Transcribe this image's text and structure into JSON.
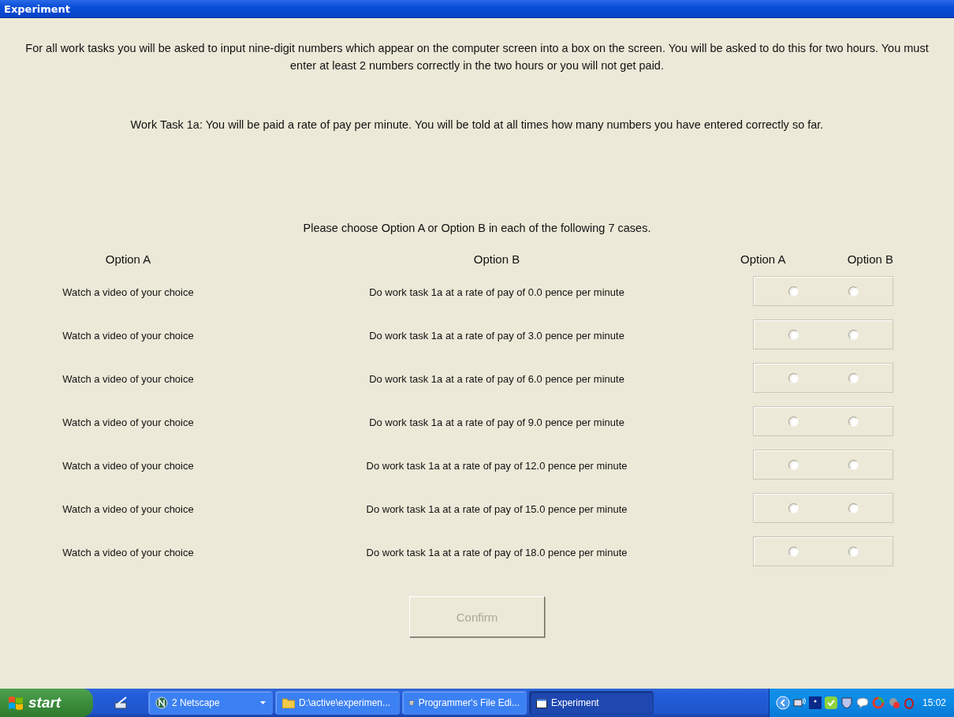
{
  "window": {
    "title": "Experiment"
  },
  "intro": [
    "For all work tasks you will be asked to input nine-digit numbers which appear on the computer screen into a box on the screen. You will be asked to do this for two hours. You must enter at least 2 numbers correctly in the two hours or you will not get paid.",
    "Work Task 1a: You will be paid a rate of pay per minute. You will be told at all times how many numbers you have entered correctly so far."
  ],
  "prompt": "Please choose Option A or Option B in each of the following 7 cases.",
  "headers": {
    "option_a": "Option A",
    "option_b": "Option B",
    "choice_a": "Option A",
    "choice_b": "Option B"
  },
  "rows": [
    {
      "option_a": "Watch a video of your choice",
      "option_b": "Do work task 1a at a rate of pay of 0.0 pence per minute",
      "choice_a": {
        "selected": false
      },
      "choice_b": {
        "selected": false
      }
    },
    {
      "option_a": "Watch a video of your choice",
      "option_b": "Do work task 1a at a rate of pay of 3.0 pence per minute",
      "choice_a": {
        "selected": false
      },
      "choice_b": {
        "selected": false
      }
    },
    {
      "option_a": "Watch a video of your choice",
      "option_b": "Do work task 1a at a rate of pay of 6.0 pence per minute",
      "choice_a": {
        "selected": false
      },
      "choice_b": {
        "selected": false
      }
    },
    {
      "option_a": "Watch a video of your choice",
      "option_b": "Do work task 1a at a rate of pay of 9.0 pence per minute",
      "choice_a": {
        "selected": false
      },
      "choice_b": {
        "selected": false
      }
    },
    {
      "option_a": "Watch a video of your choice",
      "option_b": "Do work task 1a at a rate of pay of 12.0 pence per minute",
      "choice_a": {
        "selected": false
      },
      "choice_b": {
        "selected": false
      }
    },
    {
      "option_a": "Watch a video of your choice",
      "option_b": "Do work task 1a at a rate of pay of 15.0 pence per minute",
      "choice_a": {
        "selected": false
      },
      "choice_b": {
        "selected": false
      }
    },
    {
      "option_a": "Watch a video of your choice",
      "option_b": "Do work task 1a at a rate of pay of 18.0 pence per minute",
      "choice_a": {
        "selected": false
      },
      "choice_b": {
        "selected": false
      }
    }
  ],
  "confirm": {
    "label": "Confirm",
    "disabled": true
  },
  "taskbar": {
    "start": "start",
    "tasks": [
      {
        "label": "2 Netscape",
        "kind": "group",
        "selected": false
      },
      {
        "label": "D:\\active\\experimen...",
        "kind": "folder",
        "selected": false
      },
      {
        "label": "Programmer's File Edi...",
        "kind": "editor",
        "selected": false
      },
      {
        "label": "Experiment",
        "kind": "window",
        "selected": true
      }
    ],
    "clock": "15:02"
  }
}
